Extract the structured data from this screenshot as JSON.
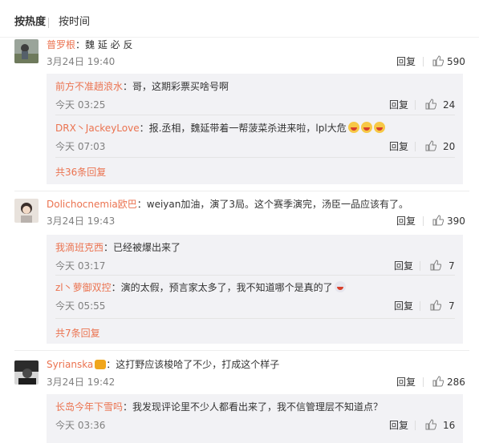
{
  "sort": {
    "hot": "按热度",
    "time": "按时间"
  },
  "comments": [
    {
      "user": "普罗根",
      "text": "：魏 延 必 反",
      "time": "3月24日 19:40",
      "reply": "回复",
      "likes": "590",
      "subs": [
        {
          "user": "前方不准趟浪水",
          "text": "：哥，这期彩票买啥号啊",
          "time": "今天 03:25",
          "reply": "回复",
          "likes": "24"
        },
        {
          "user": "DRX丶JackeyLove",
          "text": "：报.丞相，魏延带着一帮菠菜杀进来啦，lpl大危",
          "time": "今天 07:03",
          "reply": "回复",
          "likes": "20"
        }
      ],
      "more": "共36条回复"
    },
    {
      "user": "Dolichocnemia欧巴",
      "text": "：weiyan加油，演了3局。这个赛季演完，汤臣一品应该有了。",
      "time": "3月24日 19:43",
      "reply": "回复",
      "likes": "390",
      "subs": [
        {
          "user": "我滴班克西",
          "text": "：已经被爆出来了",
          "time": "今天 03:17",
          "reply": "回复",
          "likes": "7"
        },
        {
          "user": "zl丶萝御双控",
          "text": "：演的太假，预言家太多了，我不知道哪个是真的了",
          "time": "今天 05:55",
          "reply": "回复",
          "likes": "7"
        }
      ],
      "more": "共7条回复"
    },
    {
      "user": "Syrianska",
      "text": "：这打野应该梭哈了不少，打成这个样子",
      "time": "3月24日 19:42",
      "reply": "回复",
      "likes": "286",
      "subs": [
        {
          "user": "长岛今年下雪吗",
          "text": "：我发现评论里不少人都看出来了，我不信管理层不知道点？",
          "time": "今天 03:36",
          "reply": "回复",
          "likes": "16"
        }
      ]
    }
  ],
  "colors": {
    "username": "#eb7350",
    "subBg": "#f2f2f5",
    "timeGray": "#808080"
  }
}
